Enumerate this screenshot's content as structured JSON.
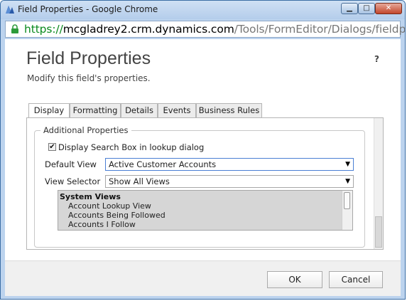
{
  "window": {
    "title": "Field Properties - Google Chrome",
    "minimize_glyph": "▁",
    "maximize_glyph": "□",
    "close_glyph": "✕"
  },
  "address_bar": {
    "scheme": "https://",
    "host": "mcgladrey2.crm.dynamics.com",
    "path": "/Tools/FormEditor/Dialogs/fieldprops.aspx"
  },
  "dialog": {
    "title": "Field Properties",
    "subtitle": "Modify this field's properties.",
    "help": "?"
  },
  "tabs": [
    {
      "label": "Display",
      "active": true
    },
    {
      "label": "Formatting",
      "active": false
    },
    {
      "label": "Details",
      "active": false
    },
    {
      "label": "Events",
      "active": false
    },
    {
      "label": "Business Rules",
      "active": false
    }
  ],
  "additional_properties": {
    "legend": "Additional Properties",
    "search_box": {
      "label": "Display Search Box in lookup dialog",
      "checked": true,
      "glyph": "✔"
    },
    "default_view": {
      "label": "Default View",
      "value": "Active Customer Accounts"
    },
    "view_selector": {
      "label": "View Selector",
      "value": "Show All Views"
    },
    "dropdown_glyph": "▼",
    "views_list": {
      "group": "System Views",
      "items": [
        "Account Lookup View",
        "Accounts Being Followed",
        "Accounts I Follow"
      ]
    }
  },
  "footer": {
    "ok_label": "OK",
    "cancel_label": "Cancel"
  },
  "colors": {
    "window_frame": "#bcd3ee",
    "url_scheme": "#0a8a1e",
    "focus_border": "#4a7fd4",
    "list_selected_bg": "#d6d6d6"
  }
}
